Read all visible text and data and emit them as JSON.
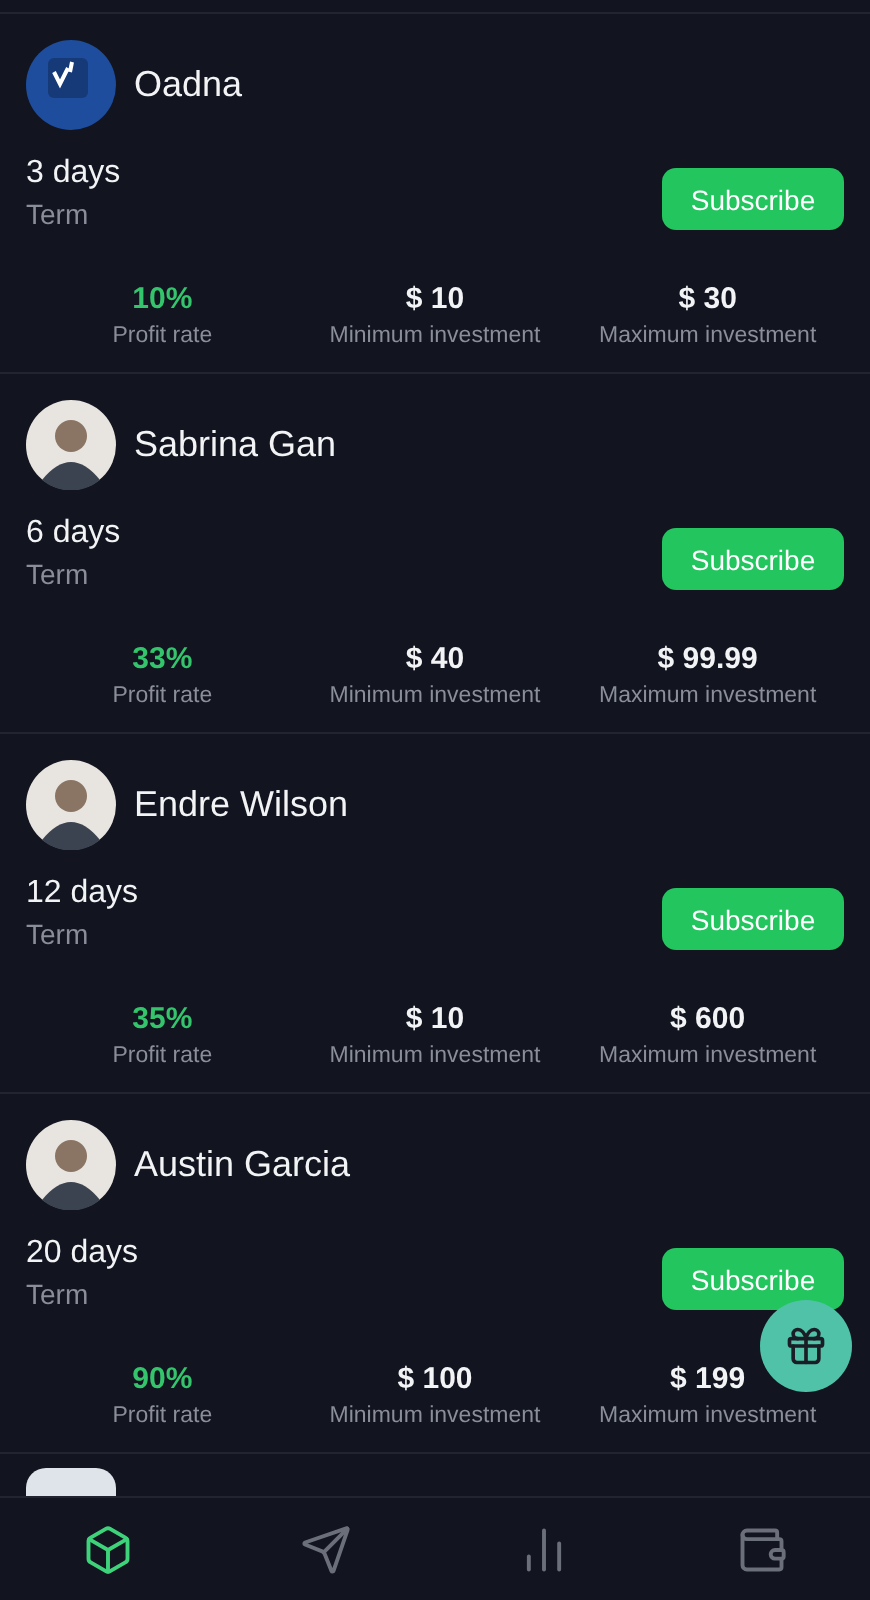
{
  "plans": [
    {
      "name": "Oadna",
      "kind": "logo",
      "term_value": "3 days",
      "term_label": "Term",
      "button": "Subscribe",
      "stats": [
        {
          "value": "10%",
          "label": "Profit rate",
          "kind": "rate"
        },
        {
          "value": "$ 10",
          "label": "Minimum investment",
          "kind": "amount"
        },
        {
          "value": "$ 30",
          "label": "Maximum investment",
          "kind": "amount"
        }
      ]
    },
    {
      "name": "Sabrina Gan",
      "kind": "person",
      "term_value": "6 days",
      "term_label": "Term",
      "button": "Subscribe",
      "stats": [
        {
          "value": "33%",
          "label": "Profit rate",
          "kind": "rate"
        },
        {
          "value": "$ 40",
          "label": "Minimum investment",
          "kind": "amount"
        },
        {
          "value": "$ 99.99",
          "label": "Maximum investment",
          "kind": "amount"
        }
      ]
    },
    {
      "name": "Endre Wilson",
      "kind": "person",
      "term_value": "12 days",
      "term_label": "Term",
      "button": "Subscribe",
      "stats": [
        {
          "value": "35%",
          "label": "Profit rate",
          "kind": "rate"
        },
        {
          "value": "$ 10",
          "label": "Minimum investment",
          "kind": "amount"
        },
        {
          "value": "$ 600",
          "label": "Maximum investment",
          "kind": "amount"
        }
      ]
    },
    {
      "name": "Austin Garcia",
      "kind": "person",
      "term_value": "20 days",
      "term_label": "Term",
      "button": "Subscribe",
      "stats": [
        {
          "value": "90%",
          "label": "Profit rate",
          "kind": "rate"
        },
        {
          "value": "$ 100",
          "label": "Minimum investment",
          "kind": "amount"
        },
        {
          "value": "$ 199",
          "label": "Maximum investment",
          "kind": "amount"
        }
      ]
    }
  ],
  "nav": [
    {
      "selected": true
    },
    {
      "selected": false
    },
    {
      "selected": false
    },
    {
      "selected": false
    }
  ]
}
